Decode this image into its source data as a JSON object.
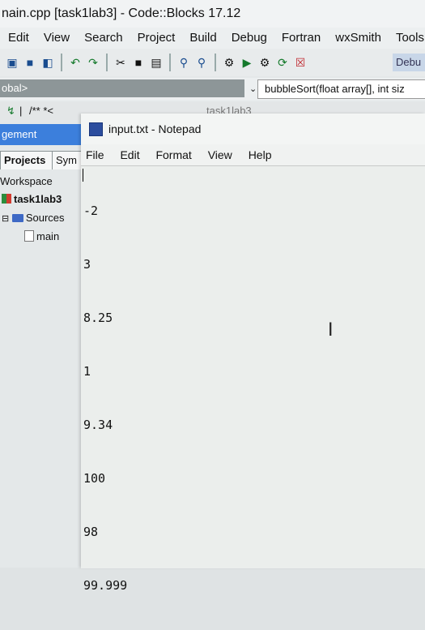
{
  "codeblocks": {
    "title": "nain.cpp [task1lab3] - Code::Blocks 17.12",
    "menu": [
      "Edit",
      "View",
      "Search",
      "Project",
      "Build",
      "Debug",
      "Fortran",
      "wxSmith",
      "Tools"
    ],
    "debug_label": "Debu",
    "scope_left": "obal>",
    "scope_right": "bubbleSort(float array[], int siz",
    "toolbar2_text": "/** *<",
    "toolbar2_tab": "task1lab3",
    "management_header": "gement",
    "tabs": [
      "Projects",
      "Sym"
    ],
    "tree": {
      "workspace": "Workspace",
      "project": "task1lab3",
      "sources": "Sources",
      "file": "main"
    }
  },
  "notepad": {
    "title": "input.txt - Notepad",
    "menu": [
      "File",
      "Edit",
      "Format",
      "View",
      "Help"
    ],
    "lines": [
      "-2",
      "3",
      "8.25",
      "1",
      "9.34",
      "100",
      "98",
      "99.999"
    ]
  }
}
